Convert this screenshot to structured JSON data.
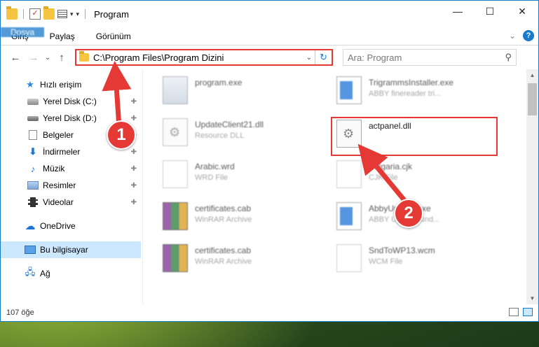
{
  "window": {
    "title": "Program",
    "controls": {
      "minimize": "—",
      "maximize": "☐",
      "close": "✕"
    }
  },
  "ribbon": {
    "tabs": [
      "Dosya",
      "Giriş",
      "Paylaş",
      "Görünüm"
    ],
    "expand": "⌄",
    "help": "?"
  },
  "nav": {
    "back": "←",
    "forward": "→",
    "recent": "⌄",
    "up": "↑",
    "address": "C:\\Program Files\\Program Dizini",
    "address_dropdown": "⌄",
    "refresh": "↻",
    "search_placeholder": "Ara: Program",
    "search_icon": "⚲"
  },
  "sidebar": {
    "quick_access": "Hızlı erişim",
    "items": [
      {
        "label": "Yerel Disk (C:)",
        "icon": "disk-icon",
        "pinned": true
      },
      {
        "label": "Yerel Disk (D:)",
        "icon": "disk-icon",
        "pinned": true
      },
      {
        "label": "Belgeler",
        "icon": "document-icon",
        "pinned": true
      },
      {
        "label": "İndirmeler",
        "icon": "download-icon",
        "pinned": true
      },
      {
        "label": "Müzik",
        "icon": "music-icon",
        "pinned": true
      },
      {
        "label": "Resimler",
        "icon": "pictures-icon",
        "pinned": true
      },
      {
        "label": "Videolar",
        "icon": "videos-icon",
        "pinned": true
      }
    ],
    "onedrive": "OneDrive",
    "this_pc": "Bu bilgisayar",
    "network": "Ağ",
    "pin_glyph": "📌"
  },
  "files": [
    {
      "name": "program.exe",
      "type": "",
      "icon": "exe-icon"
    },
    {
      "name": "TrigrammsInstaller.exe",
      "type": "ABBY finereader tri...",
      "icon": "installer-icon"
    },
    {
      "name": "UpdateClient21.dll",
      "type": "Resource DLL",
      "icon": "gear-file-icon"
    },
    {
      "name": "actpanel.dll",
      "type": "",
      "icon": "gear-file-icon"
    },
    {
      "name": "Arabic.wrd",
      "type": "WRD File",
      "icon": "blank-file-icon"
    },
    {
      "name": "Bulgaria.cjk",
      "type": "CJK File",
      "icon": "blank-file-icon"
    },
    {
      "name": "certificates.cab",
      "type": "WinRAR Archive",
      "icon": "rar-icon"
    },
    {
      "name": "AbbyUpdate.exe",
      "type": "ABBY Update fund...",
      "icon": "installer-icon"
    },
    {
      "name": "certificates.cab",
      "type": "WinRAR Archive",
      "icon": "rar-icon"
    },
    {
      "name": "SndToWP13.wcm",
      "type": "WCM File",
      "icon": "blank-file-icon"
    }
  ],
  "status": {
    "count": "107 öğe"
  },
  "callouts": {
    "one": "1",
    "two": "2"
  },
  "colors": {
    "accent": "#1979ca",
    "highlight": "#e53935",
    "selected": "#cce8ff"
  }
}
